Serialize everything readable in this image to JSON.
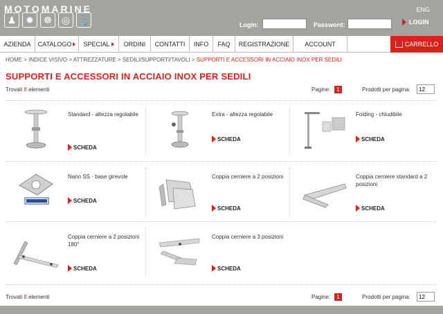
{
  "header": {
    "brand": "MOTOMARINE",
    "language": "ENG",
    "login_label": "Login:",
    "password_label": "Password:",
    "login_value": "",
    "password_value": "",
    "login_button": "LOGIN",
    "icons": [
      "swimmer-icon",
      "fan-icon",
      "wheel-icon",
      "lifebuoy-icon",
      "anchor-icon"
    ]
  },
  "nav": {
    "items": [
      {
        "label": "AZIENDA",
        "arrow": false
      },
      {
        "label": "CATALOGO",
        "arrow": true
      },
      {
        "label": "SPECIAL",
        "arrow": true
      },
      {
        "label": "ORDINI",
        "arrow": false
      },
      {
        "label": "CONTATTI",
        "arrow": false
      },
      {
        "label": "INFO",
        "arrow": false
      },
      {
        "label": "FAQ",
        "arrow": false
      },
      {
        "label": "REGISTRAZIONE",
        "arrow": false
      },
      {
        "label": "ACCOUNT",
        "arrow": false
      }
    ],
    "cart": "CARRELLO"
  },
  "breadcrumb": {
    "path": "HOME > INDICE VISIVO > ATTREZZATURE > SEDILI/SUPPORTI/TAVOLI > ",
    "current": "SUPPORTI E ACCESSORI IN ACCIAIO INOX PER SEDILI"
  },
  "page_title": "SUPPORTI E ACCESSORI IN ACCIAIO INOX PER SEDILI",
  "listing": {
    "found_prefix": "Trovati",
    "found_count": "8",
    "found_suffix": "elementi",
    "pages_label": "Pagine:",
    "page_current": "1",
    "per_page_label": "Prodotti per pagina:",
    "per_page_value": "12"
  },
  "products": [
    {
      "name": "Standard - altezza regolabile",
      "link": "SCHEDA",
      "icon": "pedestal-icon"
    },
    {
      "name": "Extra - altezza regolabile",
      "link": "SCHEDA",
      "icon": "pedestal-extra-icon"
    },
    {
      "name": "Folding - chiudibile",
      "link": "SCHEDA",
      "icon": "folding-support-icon"
    },
    {
      "name": "Nano SS - base girevole",
      "link": "SCHEDA",
      "icon": "swivel-base-icon"
    },
    {
      "name": "Coppia cerniere a 2 posizioni",
      "link": "SCHEDA",
      "icon": "hinge-icon"
    },
    {
      "name": "Coppia cerniere standard a 2 posizioni",
      "link": "SCHEDA",
      "icon": "hinge-standard-icon"
    },
    {
      "name": "Coppia cerniere a 2 posizioni 180°",
      "link": "SCHEDA",
      "icon": "hinge-180-icon"
    },
    {
      "name": "Coppia cerniere a 3 posizioni",
      "link": "SCHEDA",
      "icon": "hinge-3pos-icon"
    }
  ],
  "colors": {
    "accent": "#d8231c",
    "header_bg": "#a2a49e"
  }
}
